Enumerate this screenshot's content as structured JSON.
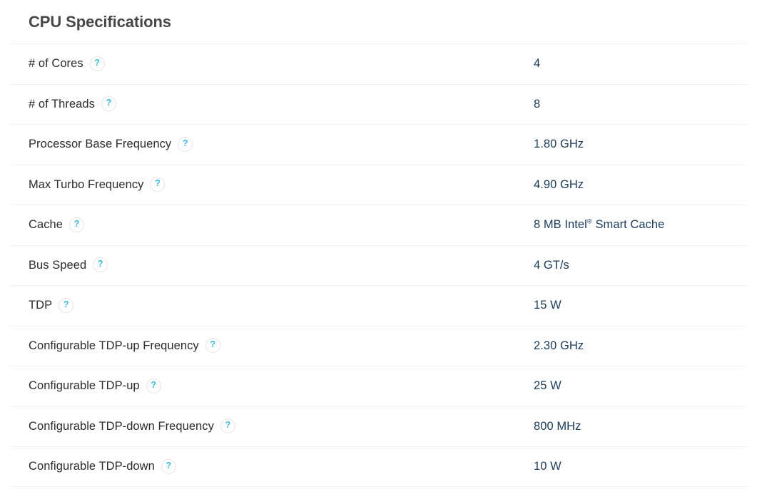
{
  "panel": {
    "title": "CPU Specifications",
    "help_icon_glyph": "?",
    "help_icon_name": "question-mark-help-icon",
    "colors": {
      "title": "#474747",
      "label": "#2c2c2c",
      "value": "#1a3a5a",
      "help_icon_glyph": "#3bb9e0",
      "help_icon_border": "#e3e5e6",
      "row_separator": "#f1f2f3",
      "background": "#ffffff"
    }
  },
  "specs": [
    {
      "label": "# of Cores",
      "value": "4",
      "value_suffix": ""
    },
    {
      "label": "# of Threads",
      "value": "8",
      "value_suffix": ""
    },
    {
      "label": "Processor Base Frequency",
      "value": "1.80 GHz",
      "value_suffix": ""
    },
    {
      "label": "Max Turbo Frequency",
      "value": "4.90 GHz",
      "value_suffix": ""
    },
    {
      "label": "Cache",
      "value": "8 MB Intel",
      "value_suffix": " Smart Cache",
      "value_sup": "®"
    },
    {
      "label": "Bus Speed",
      "value": "4 GT/s",
      "value_suffix": ""
    },
    {
      "label": "TDP",
      "value": "15 W",
      "value_suffix": ""
    },
    {
      "label": "Configurable TDP-up Frequency",
      "value": "2.30 GHz",
      "value_suffix": ""
    },
    {
      "label": "Configurable TDP-up",
      "value": "25 W",
      "value_suffix": ""
    },
    {
      "label": "Configurable TDP-down Frequency",
      "value": "800 MHz",
      "value_suffix": ""
    },
    {
      "label": "Configurable TDP-down",
      "value": "10 W",
      "value_suffix": ""
    }
  ]
}
